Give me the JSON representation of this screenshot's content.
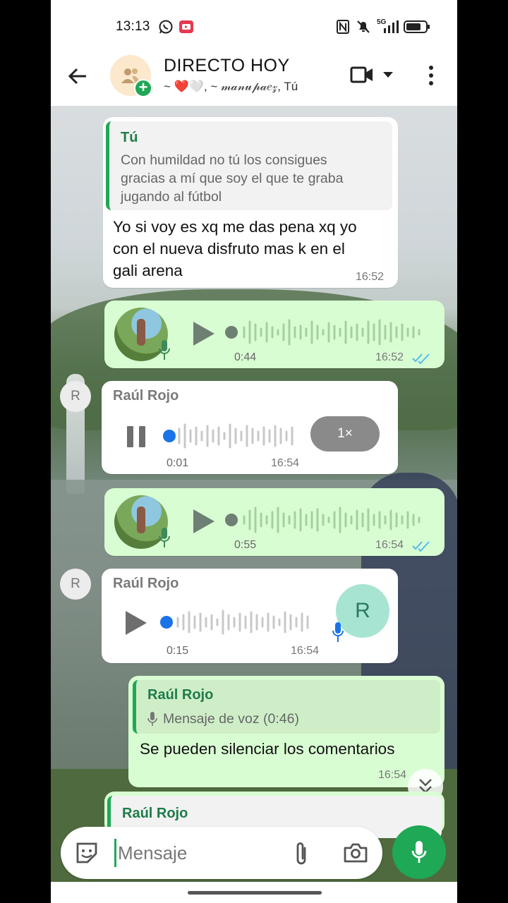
{
  "status_bar": {
    "time": "13:13",
    "network": "5G"
  },
  "header": {
    "title": "DIRECTO HOY",
    "subtitle": "~ ❤️🤍, ~ 𝓂𝒶𝓃𝓊𝓅𝒶𝑒𝓏, Tú",
    "icons": [
      "back-arrow-icon",
      "group-avatar-icon",
      "video-call-icon",
      "dropdown-icon",
      "more-options-icon"
    ]
  },
  "messages": {
    "m1": {
      "quote_name": "Tú",
      "quote_line1": "Con humildad no tú los consigues",
      "quote_line2": "gracias a mí que soy el que te graba",
      "quote_line3": "jugando al fútbol",
      "line1": "Yo si voy es xq me das pena xq yo",
      "line2": "con el nueva disfruto mas k en el",
      "line3": "gali arena",
      "time": "16:52"
    },
    "m2": {
      "duration": "0:44",
      "time": "16:52",
      "status": "read"
    },
    "m3": {
      "avatar_letter": "R",
      "sender": "Raúl Rojo",
      "duration": "0:01",
      "time": "16:54",
      "speed": "1×",
      "state": "playing"
    },
    "m4": {
      "duration": "0:55",
      "time": "16:54",
      "status": "read"
    },
    "m5": {
      "avatar_letter": "R",
      "sender": "Raúl Rojo",
      "duration": "0:15",
      "time": "16:54",
      "profile_letter": "R"
    },
    "m6": {
      "quote_name": "Raúl Rojo",
      "quote_text": "Mensaje de voz (0:46)",
      "text": "Se pueden silenciar los comentarios",
      "time": "16:54"
    },
    "m7": {
      "quote_name": "Raúl Rojo"
    }
  },
  "composer": {
    "placeholder": "Mensaje",
    "icons": [
      "sticker-icon",
      "attach-icon",
      "camera-icon",
      "mic-icon"
    ]
  },
  "colors": {
    "accent": "#1fa855",
    "outgoing_bubble": "#d9fdd3",
    "incoming_bubble": "#ffffff",
    "read_ticks": "#53bdeb",
    "playing_dot": "#1a73e8"
  }
}
